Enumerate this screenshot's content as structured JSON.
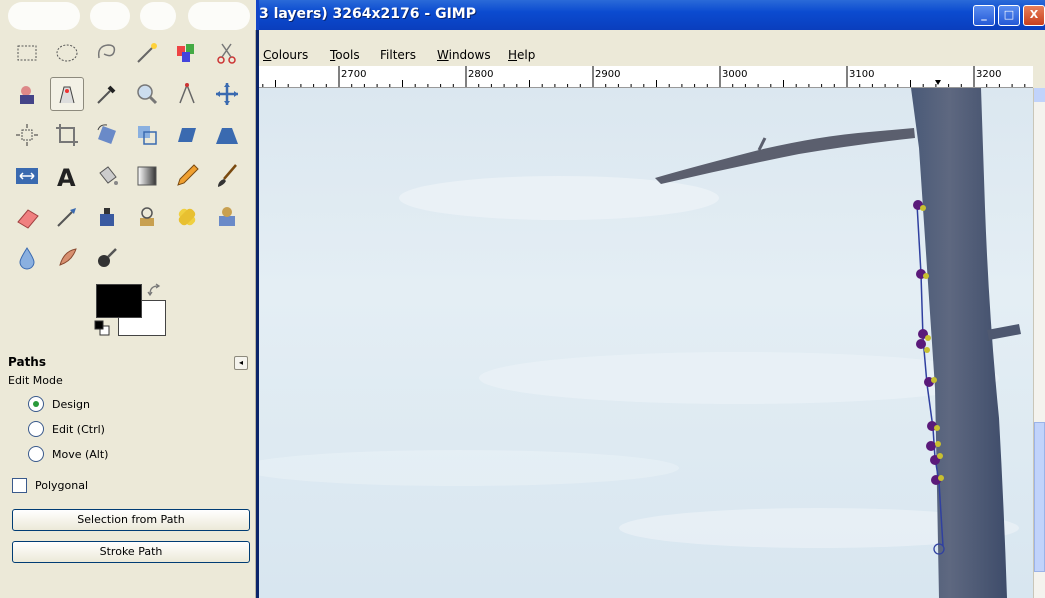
{
  "window": {
    "title": "3 layers) 3264x2176 - GIMP",
    "controls": {
      "minimize": "_",
      "maximize": "□",
      "close": "X"
    }
  },
  "menubar": {
    "items": [
      {
        "label": "Colours",
        "mnemonic": "C"
      },
      {
        "label": "Tools",
        "mnemonic": "T"
      },
      {
        "label": "Filters",
        "mnemonic": ""
      },
      {
        "label": "Windows",
        "mnemonic": "W"
      },
      {
        "label": "Help",
        "mnemonic": "H"
      }
    ]
  },
  "ruler": {
    "labels": [
      "2700",
      "2800",
      "2900",
      "3000",
      "3100",
      "3200"
    ]
  },
  "toolbox": {
    "tools": [
      "rect-select-icon",
      "ellipse-select-icon",
      "free-select-icon",
      "fuzzy-select-icon",
      "select-by-color-icon",
      "scissors-icon",
      "foreground-select-icon",
      "paths-icon",
      "color-picker-icon",
      "zoom-icon",
      "measure-icon",
      "move-icon",
      "align-icon",
      "crop-icon",
      "rotate-icon",
      "scale-icon",
      "shear-icon",
      "perspective-icon",
      "flip-icon",
      "text-icon",
      "bucket-fill-icon",
      "blend-icon",
      "pencil-icon",
      "paintbrush-icon",
      "eraser-icon",
      "airbrush-icon",
      "ink-icon",
      "clone-icon",
      "heal-icon",
      "perspective-clone-icon",
      "blur-icon",
      "smudge-icon",
      "dodge-burn-icon"
    ],
    "active_tool": "paths-icon",
    "colors": {
      "foreground": "#000000",
      "background": "#ffffff"
    }
  },
  "tool_options": {
    "title": "Paths",
    "edit_mode_label": "Edit Mode",
    "modes": [
      {
        "label": "Design",
        "checked": true
      },
      {
        "label": "Edit (Ctrl)",
        "checked": false
      },
      {
        "label": "Move (Alt)",
        "checked": false
      }
    ],
    "polygonal_label": "Polygonal",
    "polygonal_checked": false,
    "selection_from_path_label": "Selection from Path",
    "stroke_path_label": "Stroke Path"
  },
  "colors": {
    "titlebar": "#0a4bd0",
    "sky": "#dde9f2",
    "anchor_purple": "#5a1a7a",
    "anchor_yellow": "#c8c030"
  }
}
